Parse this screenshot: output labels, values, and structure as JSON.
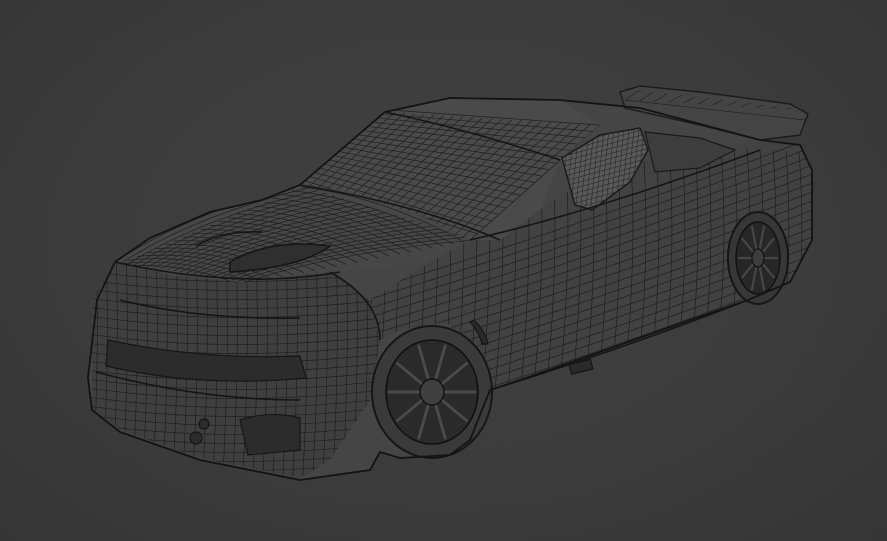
{
  "scene": {
    "subject": "wireframe-race-car",
    "colors": {
      "background": "#3c3c3c",
      "body_fill": "#464646",
      "body_shade": "#3f3f3f",
      "wire": "#1a1a1a",
      "wire_light": "#2b2b2b",
      "window_fill": "#5a5a5a",
      "tire": "#262626"
    }
  }
}
